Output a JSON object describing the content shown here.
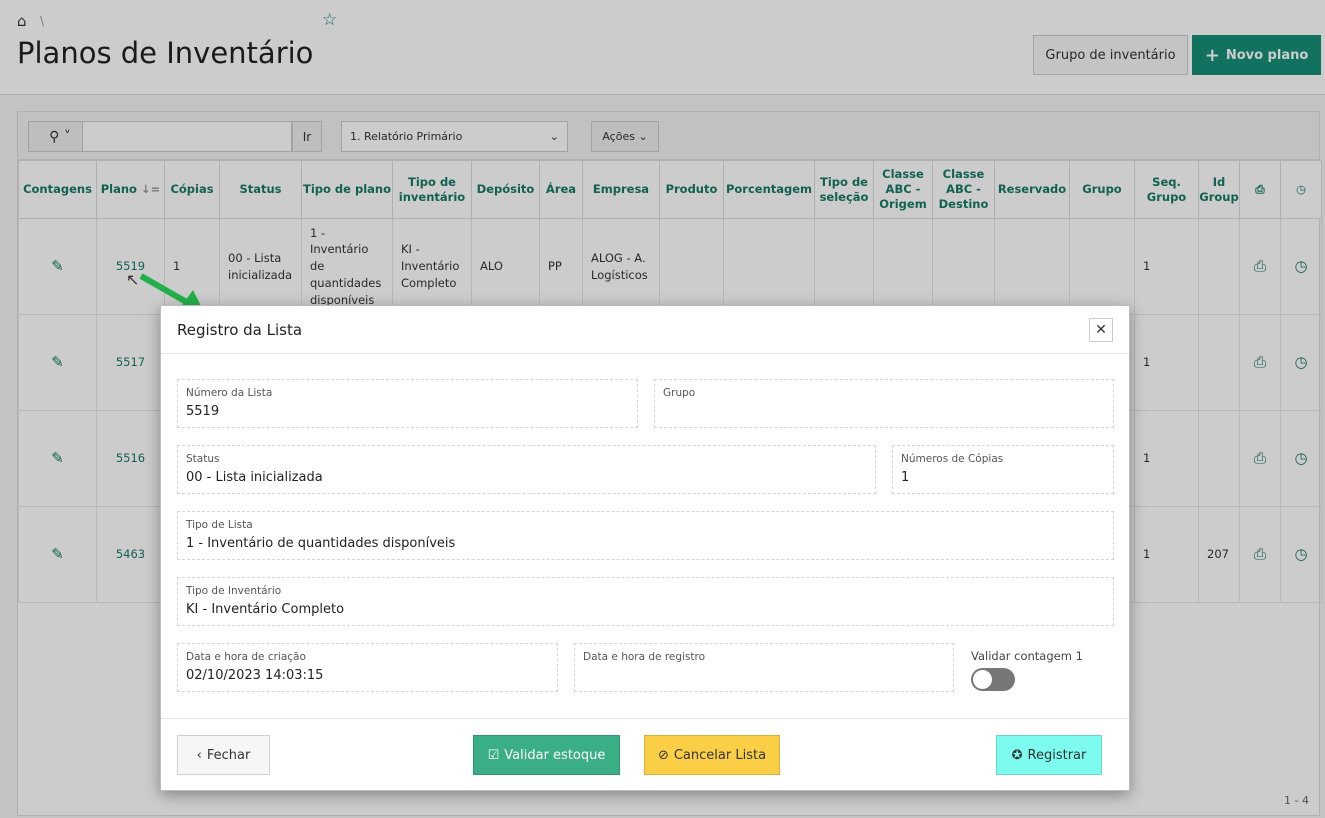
{
  "header": {
    "title": "Planos de Inventário",
    "group_button": "Grupo de inventário",
    "new_button": "Novo plano"
  },
  "toolbar": {
    "go": "Ir",
    "report": "1. Relatório Primário",
    "actions": "Ações"
  },
  "columns": [
    "Contagens",
    "Plano",
    "Cópias",
    "Status",
    "Tipo de plano",
    "Tipo de inventário",
    "Depósito",
    "Área",
    "Empresa",
    "Produto",
    "Porcentagem",
    "Tipo de seleção",
    "Classe ABC - Origem",
    "Classe ABC - Destino",
    "Reservado",
    "Grupo",
    "Seq. Grupo",
    "Id Group"
  ],
  "rows": [
    {
      "plano": "5519",
      "copias": "1",
      "status": "00 - Lista inicializada",
      "tipo_plano": "1 - Inventário de quantidades disponíveis",
      "tipo_inv": "KI - Inventário Completo",
      "deposito": "ALO",
      "area": "PP",
      "empresa": "ALOG - A. Logísticos",
      "seq": "1",
      "id": ""
    },
    {
      "plano": "5517",
      "seq": "1",
      "id": ""
    },
    {
      "plano": "5516",
      "seq": "1",
      "id": ""
    },
    {
      "plano": "5463",
      "seq": "1",
      "id": "207"
    }
  ],
  "pagination": "1 - 4",
  "modal": {
    "title": "Registro da Lista",
    "fields": {
      "numero_label": "Número da Lista",
      "numero": "5519",
      "grupo_label": "Grupo",
      "grupo": "",
      "status_label": "Status",
      "status": "00 - Lista inicializada",
      "copias_label": "Números de Cópias",
      "copias": "1",
      "tipo_lista_label": "Tipo de Lista",
      "tipo_lista": "1 - Inventário de quantidades disponíveis",
      "tipo_inv_label": "Tipo de Inventário",
      "tipo_inv": "KI - Inventário Completo",
      "criacao_label": "Data e hora de criação",
      "criacao": "02/10/2023 14:03:15",
      "registro_label": "Data e hora de registro",
      "registro": "",
      "validar_label": "Validar contagem 1"
    },
    "toggle_on": false,
    "buttons": {
      "close": "Fechar",
      "validate": "Validar estoque",
      "cancel": "Cancelar Lista",
      "register": "Registrar"
    }
  },
  "colors": {
    "accent": "#168f78",
    "validate": "#3aae84",
    "cancel": "#fbcf45",
    "register": "#7dfbef"
  }
}
